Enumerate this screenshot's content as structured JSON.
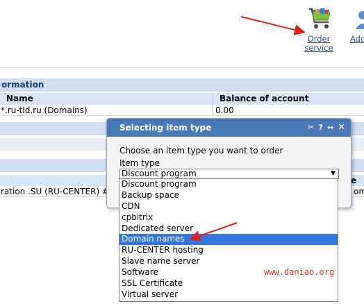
{
  "toolbar": {
    "order_label_line1": "Order",
    "order_label_line2": "service",
    "add_label": "Add"
  },
  "background": {
    "section1_title": "ormation",
    "col_name": "Name",
    "col_balance": "Balance of account",
    "row1_name": "*.ru-tld.ru (Domains)",
    "row1_balance": "0.00",
    "row_partial_name": "ration .SU (RU-CENTER) #",
    "row_partial_right": "om",
    "row_partial_header_right": "e"
  },
  "dialog": {
    "title": "Selecting item type",
    "prompt": "Choose an item type you want to order",
    "field_label": "Item type",
    "selected_value": "Discount program",
    "options": [
      "Discount program",
      "Backup space",
      "CDN",
      "cpbitrix",
      "Dedicated server",
      "Domain names",
      "RU-CENTER hosting",
      "Slave name server",
      "Software",
      "SSL Certificate",
      "Virtual server"
    ],
    "highlighted_option": "Domain names"
  },
  "watermark": "www.daniao.org",
  "colors": {
    "accent": "#4a7ab5",
    "highlight": "#3378e0",
    "annotation": "#e02020"
  }
}
